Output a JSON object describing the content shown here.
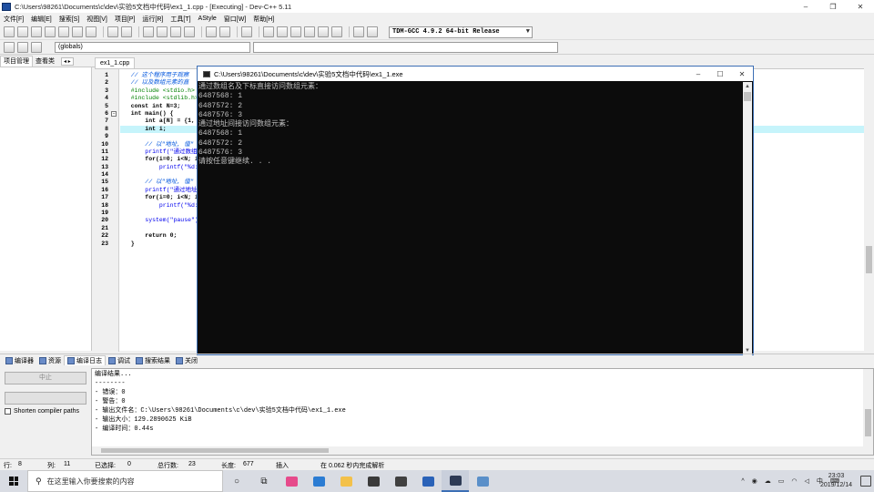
{
  "window": {
    "title": "C:\\Users\\98261\\Documents\\c\\dev\\实验5文档中代码\\ex1_1.cpp - [Executing] - Dev-C++ 5.11",
    "minimize": "–",
    "maximize": "❐",
    "close": "✕"
  },
  "menu": [
    "文件[F]",
    "编辑[E]",
    "搜索[S]",
    "视图[V]",
    "项目[P]",
    "运行[R]",
    "工具[T]",
    "AStyle",
    "窗口[W]",
    "帮助[H]"
  ],
  "toolbar": {
    "compiler": "TDM-GCC 4.9.2 64-bit Release",
    "scope": "(globals)"
  },
  "left_panel": {
    "tabs": [
      "项目管理",
      "查看类"
    ],
    "nav": "◂ ▸"
  },
  "editor": {
    "file_tab": "ex1_1.cpp",
    "lines": [
      {
        "n": "1",
        "text": "   // 这个程序用于观察"
      },
      {
        "n": "2",
        "text": "   // 以及数组元素的直"
      },
      {
        "n": "3",
        "text": "   #include <stdio.h>"
      },
      {
        "n": "4",
        "text": "   #include <stdlib.h>"
      },
      {
        "n": "5",
        "text": "   const int N=3;"
      },
      {
        "n": "6",
        "text": "   int main() {"
      },
      {
        "n": "7",
        "text": "       int a[N] = {1,"
      },
      {
        "n": "8",
        "text": "       int i;"
      },
      {
        "n": "9",
        "text": ""
      },
      {
        "n": "10",
        "text": "       // 以\"地址, 值\""
      },
      {
        "n": "11",
        "text": "       printf(\"通过数组"
      },
      {
        "n": "12",
        "text": "       for(i=0; i<N; i+"
      },
      {
        "n": "13",
        "text": "           printf(\"%d:"
      },
      {
        "n": "14",
        "text": ""
      },
      {
        "n": "15",
        "text": "       // 以\"地址, 值\""
      },
      {
        "n": "16",
        "text": "       printf(\"通过地址"
      },
      {
        "n": "17",
        "text": "       for(i=0; i<N; i+"
      },
      {
        "n": "18",
        "text": "           printf(\"%d:"
      },
      {
        "n": "19",
        "text": ""
      },
      {
        "n": "20",
        "text": "       system(\"pause\");"
      },
      {
        "n": "21",
        "text": ""
      },
      {
        "n": "22",
        "text": "       return 0;"
      },
      {
        "n": "23",
        "text": "   }"
      }
    ]
  },
  "console": {
    "title": "C:\\Users\\98261\\Documents\\c\\dev\\实验5文档中代码\\ex1_1.exe",
    "lines": [
      "通过数组名及下标直接访问数组元素：",
      "6487568: 1",
      "6487572: 2",
      "6487576: 3",
      "通过地址间接访问数组元素：",
      "6487568: 1",
      "6487572: 2",
      "6487576: 3",
      "请按任意键继续. . ."
    ]
  },
  "bottom_tabs": [
    "编译器",
    "资源",
    "编译日志",
    "调试",
    "搜索结果",
    "关闭"
  ],
  "bottom_left": {
    "stop_button": "中止",
    "shorten": "Shorten compiler paths"
  },
  "compile_log": [
    "编译结果...",
    "--------",
    "- 错误：0",
    "- 警告：0",
    "- 输出文件名：C:\\Users\\98261\\Documents\\c\\dev\\实验5文档中代码\\ex1_1.exe",
    "- 输出大小：129.2890625 KiB",
    "- 编译时间：0.44s"
  ],
  "status": {
    "row_label": "行:",
    "row": "8",
    "col_label": "列:",
    "col": "11",
    "selected_label": "已选择:",
    "selected": "0",
    "total_label": "总行数:",
    "total": "23",
    "length_label": "长度:",
    "length": "677",
    "mode": "插入",
    "parse": "在 0.062 秒内完成解析"
  },
  "taskbar": {
    "search_placeholder": "在这里输入你要搜索的内容",
    "time": "23:03",
    "date": "2019/12/14",
    "ime": "中"
  }
}
